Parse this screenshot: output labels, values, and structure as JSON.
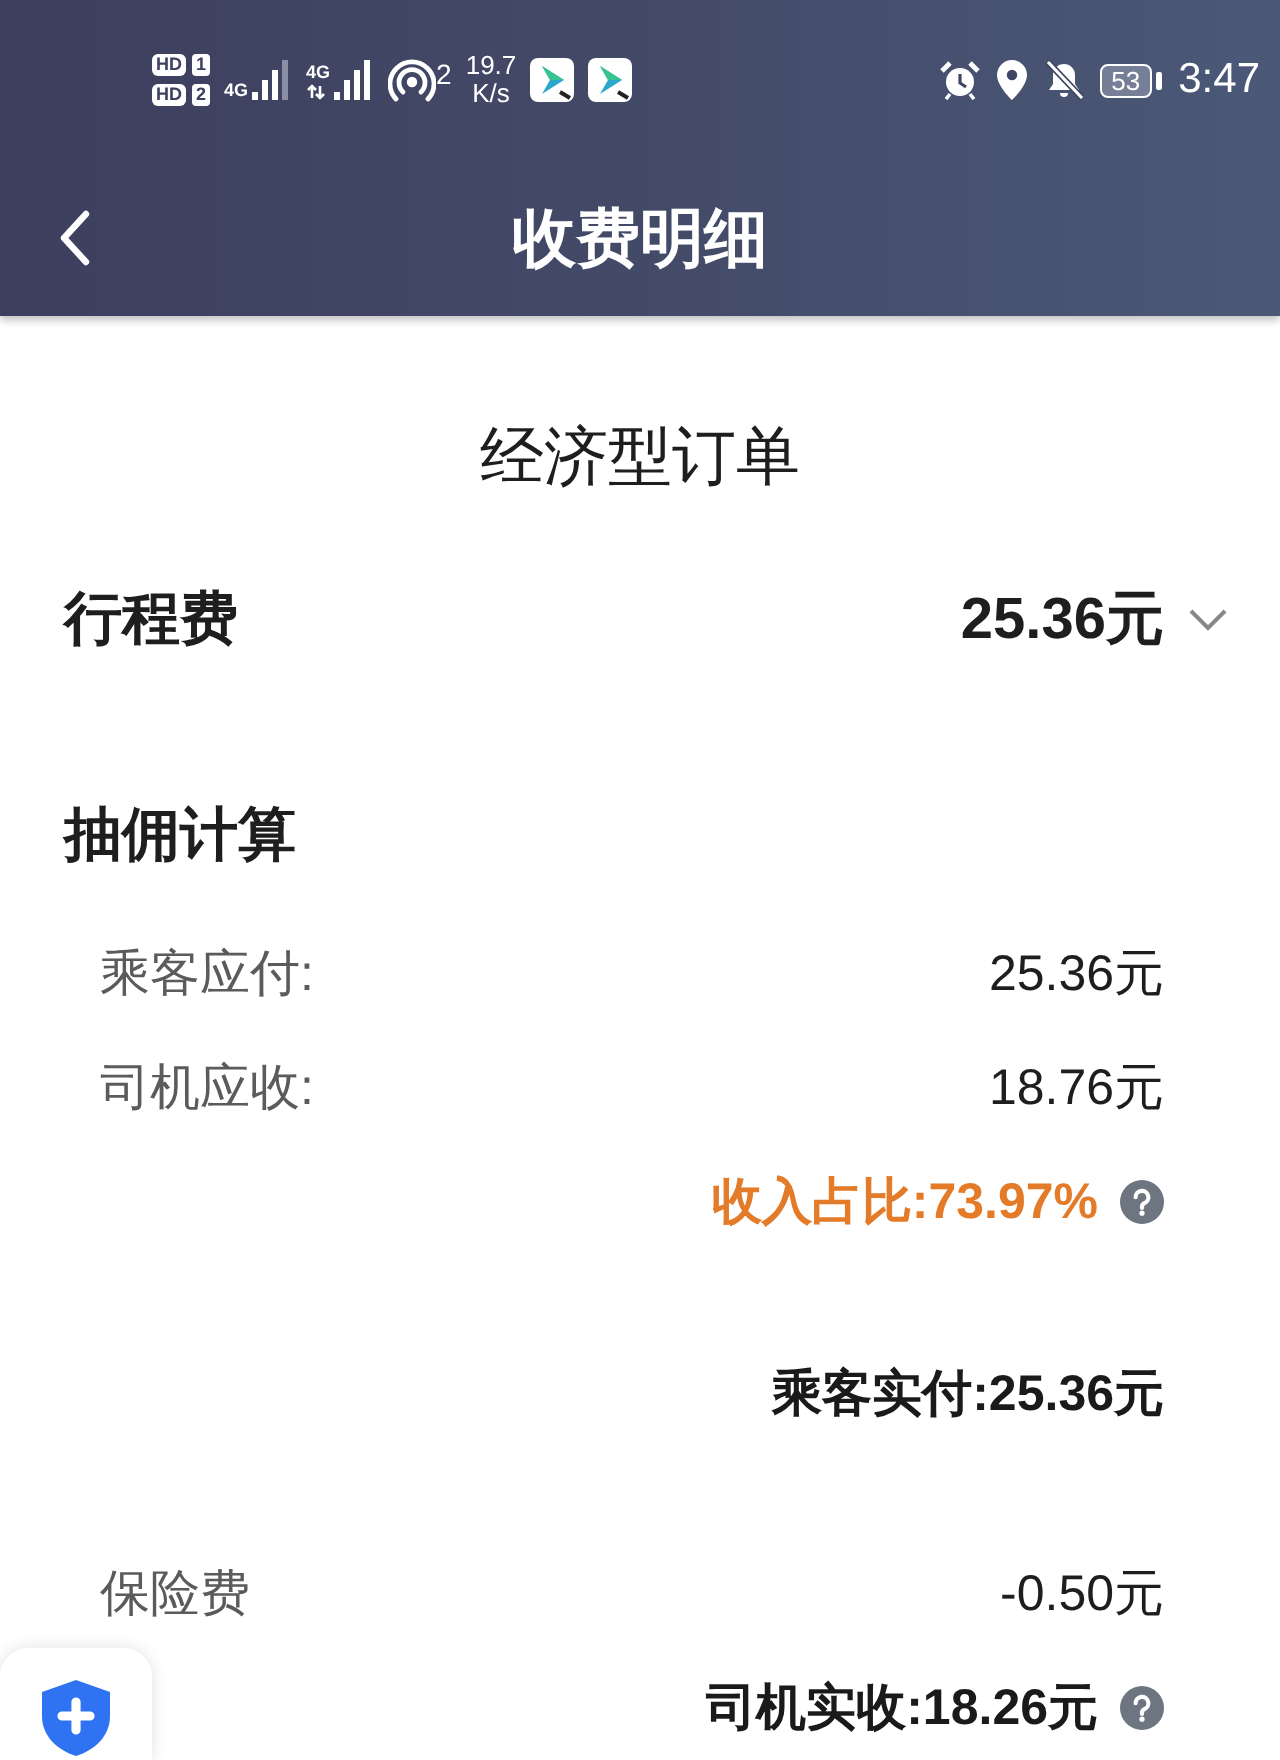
{
  "status_bar": {
    "hd_badges": [
      {
        "label": "HD",
        "slot": "1"
      },
      {
        "label": "HD",
        "slot": "2"
      }
    ],
    "networks": [
      {
        "type": "4G",
        "data_arrows": false
      },
      {
        "type": "4G",
        "data_arrows": true
      }
    ],
    "hotspot_count": "2",
    "speed": "19.7",
    "speed_unit": "K/s",
    "battery": "53",
    "time": "3:47"
  },
  "header": {
    "title": "收费明细"
  },
  "order_type": "经济型订单",
  "fare": {
    "label": "行程费",
    "value": "25.36元",
    "expanded": false
  },
  "commission": {
    "title": "抽佣计算",
    "rows": [
      {
        "kind": "item",
        "label": "乘客应付:",
        "value": "25.36元"
      },
      {
        "kind": "item",
        "label": "司机应收:",
        "value": "18.76元"
      },
      {
        "kind": "highlight",
        "text": "收入占比:73.97%",
        "help": true
      },
      {
        "kind": "total",
        "text": "乘客实付:25.36元",
        "help": false
      },
      {
        "kind": "item",
        "label": "保险费",
        "value": "-0.50元"
      },
      {
        "kind": "total",
        "text": "司机实收:18.26元",
        "help": true
      }
    ]
  }
}
